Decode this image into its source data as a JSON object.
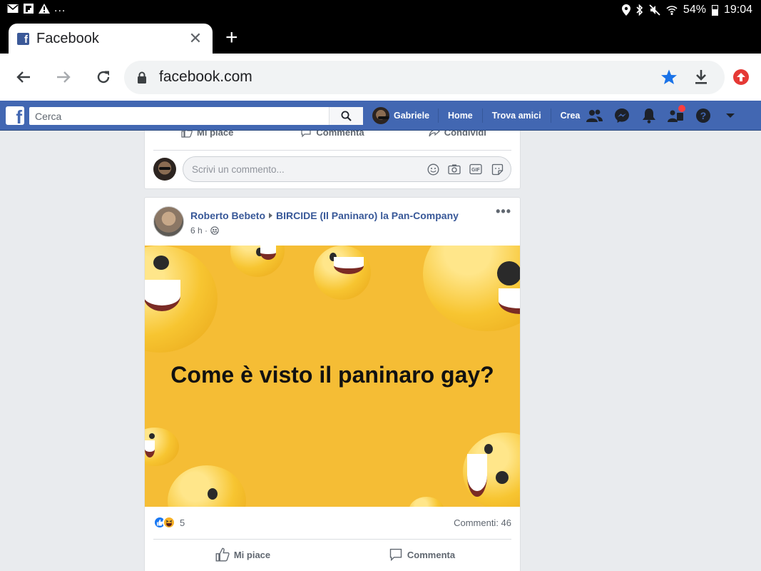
{
  "status_bar": {
    "left_icons": [
      "gmail-icon",
      "flipboard-icon",
      "warning-icon"
    ],
    "more": "...",
    "battery": "54%",
    "time": "19:04"
  },
  "browser": {
    "tab_title": "Facebook",
    "url": "facebook.com"
  },
  "fb_header": {
    "logo": "f",
    "search_placeholder": "Cerca",
    "user_name": "Gabriele",
    "nav": [
      "Home",
      "Trova amici",
      "Crea"
    ],
    "brand_color": "#4267b2"
  },
  "prev_post": {
    "actions": [
      "Mi piace",
      "Commenta",
      "Condividi"
    ],
    "comment_placeholder": "Scrivi un commento..."
  },
  "post": {
    "author": "Roberto Bebeto",
    "target": "BIRCIDE (Il Paninaro) la Pan-Company",
    "time": "6 h ·",
    "more": "•••",
    "image_text": "Come è visto il paninaro gay?",
    "reactions_count": "5",
    "comments": "Commenti: 46",
    "actions": [
      "Mi piace",
      "Commenta"
    ]
  }
}
